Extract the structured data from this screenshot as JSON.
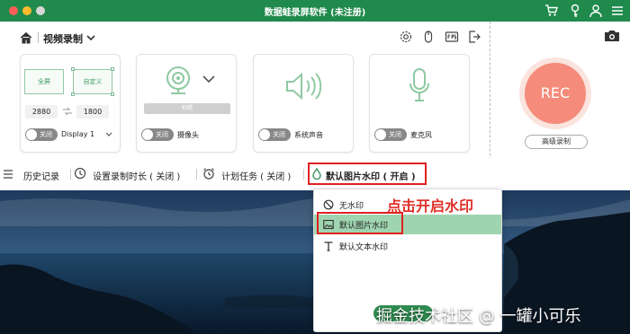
{
  "window": {
    "title": "数据蛙录屏软件 (未注册)"
  },
  "toolbar": {
    "mode_label": "视频录制"
  },
  "screen_card": {
    "fullscreen_label": "全屏",
    "custom_label": "自定义",
    "width": "2880",
    "height": "1800",
    "toggle_label": "关闭",
    "display_label": "Display 1"
  },
  "camera_card": {
    "shot_label": "拍照",
    "toggle_label": "关闭",
    "label": "摄像头"
  },
  "audio_card": {
    "toggle_label": "关闭",
    "label": "系统声音"
  },
  "mic_card": {
    "toggle_label": "关闭",
    "label": "麦克风"
  },
  "rec": {
    "label": "REC",
    "advanced_label": "高级录制"
  },
  "bottom_nav": {
    "history": "历史记录",
    "duration": "设置录制时长 ( 关闭 )",
    "schedule": "计划任务 ( 关闭 )",
    "watermark": "默认图片水印 ( 开启 )"
  },
  "dropdown": {
    "items": [
      "无水印",
      "默认图片水印",
      "默认文本水印"
    ],
    "selected_index": 1
  },
  "annotation": "点击开启水印",
  "credit": "掘金技术社区 @ 一罐小可乐",
  "colors": {
    "brand_green": "#1f8a4c",
    "rec": "#f58b7a",
    "highlight": "#e02020",
    "selected_item": "#9fd4b0"
  }
}
